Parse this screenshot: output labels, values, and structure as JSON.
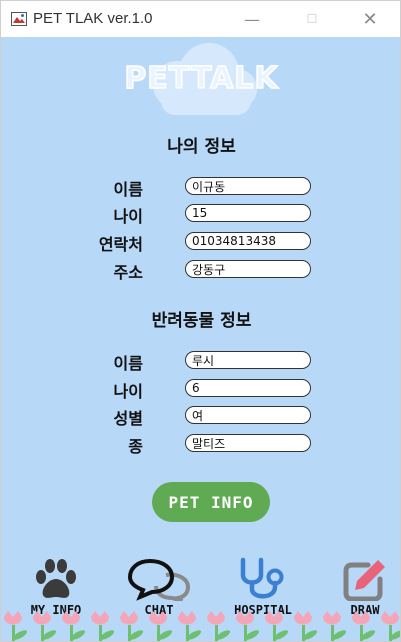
{
  "window": {
    "title": "PET TLAK ver.1.0"
  },
  "logo": {
    "text": "PETTALK"
  },
  "my_info": {
    "title": "나의 정보",
    "fields": [
      {
        "label": "이름",
        "value": "이규동"
      },
      {
        "label": "나이",
        "value": "15"
      },
      {
        "label": "연락처",
        "value": "01034813438"
      },
      {
        "label": "주소",
        "value": "강동구"
      }
    ]
  },
  "pet_info": {
    "title": "반려동물 정보",
    "fields": [
      {
        "label": "이름",
        "value": "루시"
      },
      {
        "label": "나이",
        "value": "6"
      },
      {
        "label": "성별",
        "value": "여"
      },
      {
        "label": "종",
        "value": "말티즈"
      }
    ]
  },
  "button": {
    "label": "PET INFO"
  },
  "nav": [
    {
      "label": "MY INFO",
      "icon": "paw-icon"
    },
    {
      "label": "CHAT",
      "icon": "chat-bubbles-icon"
    },
    {
      "label": "HOSPITAL",
      "icon": "stethoscope-icon"
    },
    {
      "label": "DRAW",
      "icon": "edit-icon"
    }
  ],
  "colors": {
    "background": "#b8d8f8",
    "button": "#5faa52",
    "hospital_icon": "#3a7fd0",
    "draw_icon": "#808080",
    "draw_pencil": "#e8647a",
    "tulip": "#f4a6b8",
    "leaf": "#6cc070"
  }
}
